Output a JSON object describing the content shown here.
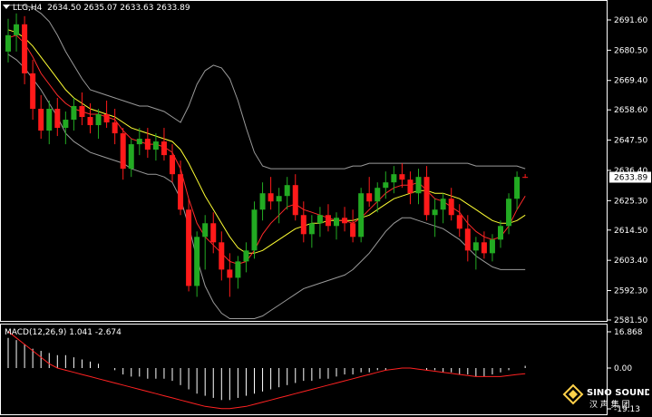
{
  "header": {
    "menu_icon": "triangle-down-icon",
    "symbol": "LLG,H4",
    "open": "2634.50",
    "high": "2635.07",
    "low": "2633.63",
    "close": "2633.89"
  },
  "price_axis": {
    "ticks": [
      "2691.60",
      "2680.50",
      "2669.40",
      "2658.60",
      "2647.50",
      "2636.40",
      "2625.30",
      "2614.50",
      "2603.40",
      "2592.30",
      "2581.50"
    ],
    "current_price": "2633.89"
  },
  "macd_panel": {
    "label": "MACD(12,26,9)",
    "macd_value": "1.041",
    "signal_value": "-2.674",
    "ticks": [
      "16.868",
      "0.00",
      "-19.13"
    ]
  },
  "watermark": {
    "brand": "SINO SOUND",
    "subtitle": "汉 声 集 团",
    "logo_icon": "sino-sound-diamond-logo"
  },
  "colors": {
    "background": "#000000",
    "bull": "#22aa22",
    "bear": "#ff1a1a",
    "ma_fast": "#ff2a2a",
    "ma_slow": "#ffff33",
    "bollinger": "#9a9a9a",
    "macd_hist": "#ffffff",
    "macd_signal": "#ff2222"
  },
  "chart_data": {
    "type": "candlestick",
    "timeframe": "H4",
    "ylim": [
      2581.5,
      2697
    ],
    "candles": [
      [
        2680,
        2692,
        2676,
        2686
      ],
      [
        2686,
        2694,
        2680,
        2690
      ],
      [
        2690,
        2693,
        2668,
        2672
      ],
      [
        2672,
        2677,
        2655,
        2659
      ],
      [
        2659,
        2664,
        2648,
        2651
      ],
      [
        2651,
        2662,
        2646,
        2659
      ],
      [
        2659,
        2663,
        2649,
        2652
      ],
      [
        2652,
        2658,
        2646,
        2655
      ],
      [
        2655,
        2663,
        2651,
        2660
      ],
      [
        2660,
        2665,
        2653,
        2656
      ],
      [
        2656,
        2661,
        2650,
        2653
      ],
      [
        2653,
        2659,
        2648,
        2657
      ],
      [
        2657,
        2662,
        2652,
        2654
      ],
      [
        2654,
        2659,
        2646,
        2650
      ],
      [
        2650,
        2652,
        2633,
        2637
      ],
      [
        2637,
        2648,
        2634,
        2646
      ],
      [
        2646,
        2652,
        2642,
        2648
      ],
      [
        2648,
        2652,
        2641,
        2644
      ],
      [
        2644,
        2650,
        2640,
        2647
      ],
      [
        2647,
        2652,
        2640,
        2642
      ],
      [
        2642,
        2646,
        2632,
        2635
      ],
      [
        2635,
        2640,
        2620,
        2622
      ],
      [
        2622,
        2626,
        2592,
        2594
      ],
      [
        2594,
        2614,
        2590,
        2612
      ],
      [
        2612,
        2620,
        2600,
        2617
      ],
      [
        2617,
        2621,
        2606,
        2610
      ],
      [
        2610,
        2614,
        2596,
        2600
      ],
      [
        2600,
        2606,
        2590,
        2597
      ],
      [
        2597,
        2605,
        2593,
        2603
      ],
      [
        2603,
        2610,
        2599,
        2607
      ],
      [
        2607,
        2625,
        2604,
        2622
      ],
      [
        2622,
        2632,
        2618,
        2628
      ],
      [
        2628,
        2634,
        2622,
        2625
      ],
      [
        2625,
        2630,
        2617,
        2627
      ],
      [
        2627,
        2634,
        2622,
        2631
      ],
      [
        2631,
        2635,
        2618,
        2620
      ],
      [
        2620,
        2625,
        2610,
        2613
      ],
      [
        2613,
        2620,
        2608,
        2617
      ],
      [
        2617,
        2623,
        2612,
        2620
      ],
      [
        2620,
        2624,
        2614,
        2616
      ],
      [
        2616,
        2621,
        2611,
        2619
      ],
      [
        2619,
        2623,
        2614,
        2617
      ],
      [
        2617,
        2622,
        2610,
        2612
      ],
      [
        2612,
        2630,
        2610,
        2628
      ],
      [
        2628,
        2634,
        2623,
        2625
      ],
      [
        2625,
        2632,
        2621,
        2630
      ],
      [
        2630,
        2636,
        2626,
        2632
      ],
      [
        2632,
        2638,
        2628,
        2635
      ],
      [
        2635,
        2639,
        2630,
        2633
      ],
      [
        2633,
        2636,
        2624,
        2628
      ],
      [
        2628,
        2637,
        2624,
        2634
      ],
      [
        2634,
        2638,
        2618,
        2620
      ],
      [
        2620,
        2626,
        2612,
        2622
      ],
      [
        2622,
        2628,
        2617,
        2626
      ],
      [
        2626,
        2630,
        2618,
        2620
      ],
      [
        2620,
        2624,
        2612,
        2615
      ],
      [
        2615,
        2620,
        2603,
        2607
      ],
      [
        2607,
        2612,
        2600,
        2610
      ],
      [
        2610,
        2614,
        2604,
        2606
      ],
      [
        2606,
        2613,
        2603,
        2611
      ],
      [
        2611,
        2618,
        2608,
        2616
      ],
      [
        2616,
        2628,
        2613,
        2626
      ],
      [
        2626,
        2636,
        2622,
        2634
      ],
      [
        2634,
        2635.07,
        2633.63,
        2633.89
      ]
    ],
    "ma_fast": [
      2685,
      2686,
      2683,
      2678,
      2672,
      2668,
      2664,
      2661,
      2659,
      2658,
      2657,
      2657,
      2656,
      2655,
      2651,
      2648,
      2647,
      2646,
      2646,
      2645,
      2643,
      2637,
      2626,
      2617,
      2612,
      2609,
      2606,
      2603,
      2602,
      2603,
      2607,
      2613,
      2617,
      2620,
      2623,
      2624,
      2622,
      2621,
      2620,
      2619,
      2618,
      2618,
      2617,
      2619,
      2622,
      2625,
      2628,
      2630,
      2631,
      2631,
      2632,
      2629,
      2626,
      2625,
      2623,
      2621,
      2617,
      2614,
      2612,
      2611,
      2612,
      2616,
      2622,
      2627
    ],
    "ma_slow": [
      2688,
      2687,
      2685,
      2682,
      2678,
      2674,
      2670,
      2666,
      2663,
      2661,
      2659,
      2658,
      2657,
      2656,
      2654,
      2652,
      2651,
      2650,
      2649,
      2648,
      2647,
      2644,
      2639,
      2633,
      2627,
      2622,
      2617,
      2612,
      2608,
      2606,
      2606,
      2607,
      2609,
      2611,
      2613,
      2615,
      2616,
      2617,
      2617,
      2618,
      2618,
      2618,
      2618,
      2619,
      2620,
      2622,
      2624,
      2626,
      2627,
      2628,
      2629,
      2629,
      2628,
      2628,
      2627,
      2626,
      2624,
      2622,
      2620,
      2618,
      2617,
      2617,
      2618,
      2620
    ],
    "bb_upper": [
      2697,
      2697,
      2697,
      2696,
      2694,
      2691,
      2686,
      2680,
      2675,
      2670,
      2666,
      2665,
      2664,
      2663,
      2662,
      2661,
      2660,
      2660,
      2659,
      2658,
      2656,
      2654,
      2660,
      2668,
      2673,
      2675,
      2674,
      2670,
      2662,
      2652,
      2643,
      2638,
      2637,
      2637,
      2637,
      2637,
      2637,
      2637,
      2637,
      2637,
      2637,
      2637,
      2638,
      2638,
      2639,
      2639,
      2639,
      2639,
      2639,
      2639,
      2639,
      2639,
      2639,
      2639,
      2639,
      2639,
      2639,
      2638,
      2638,
      2638,
      2638,
      2638,
      2638,
      2637
    ],
    "bb_lower": [
      2679,
      2677,
      2674,
      2670,
      2666,
      2661,
      2656,
      2650,
      2647,
      2645,
      2643,
      2642,
      2641,
      2640,
      2639,
      2637,
      2636,
      2635,
      2635,
      2634,
      2632,
      2626,
      2616,
      2604,
      2594,
      2588,
      2584,
      2582,
      2582,
      2582,
      2582,
      2583,
      2585,
      2587,
      2589,
      2591,
      2593,
      2594,
      2595,
      2596,
      2597,
      2598,
      2600,
      2603,
      2606,
      2610,
      2614,
      2617,
      2619,
      2619,
      2618,
      2617,
      2616,
      2615,
      2613,
      2611,
      2608,
      2605,
      2603,
      2601,
      2600,
      2600,
      2600,
      2600
    ],
    "macd_hist": [
      14,
      13,
      11,
      9,
      8,
      7,
      6,
      6,
      5,
      4,
      3,
      2,
      0,
      -1,
      -3,
      -4,
      -4,
      -5,
      -5,
      -5,
      -6,
      -8,
      -10,
      -12,
      -13,
      -14,
      -15,
      -15,
      -14,
      -13,
      -12,
      -11,
      -10,
      -9,
      -8,
      -7,
      -6,
      -6,
      -5,
      -5,
      -4,
      -3,
      -3,
      -2,
      -2,
      -1,
      -1,
      0,
      0,
      0,
      0,
      -1,
      -1,
      -2,
      -2,
      -3,
      -3,
      -4,
      -4,
      -3,
      -2,
      -1,
      0,
      1.041
    ],
    "macd_signal": [
      17,
      14,
      11,
      8,
      5,
      2,
      0,
      -1,
      -2,
      -3,
      -4,
      -5,
      -6,
      -7,
      -8,
      -9,
      -10,
      -11,
      -12,
      -13,
      -14,
      -15,
      -16,
      -17,
      -18,
      -18.5,
      -19,
      -19,
      -18.5,
      -18,
      -17,
      -16,
      -15,
      -14,
      -13,
      -12,
      -11,
      -10,
      -9,
      -8,
      -7,
      -6,
      -5,
      -4,
      -3,
      -2,
      -1,
      -0.5,
      0,
      0,
      -0.5,
      -1,
      -1.5,
      -2,
      -2.5,
      -3,
      -3.5,
      -4,
      -4,
      -4,
      -4,
      -3.5,
      -3,
      -2.674
    ]
  }
}
